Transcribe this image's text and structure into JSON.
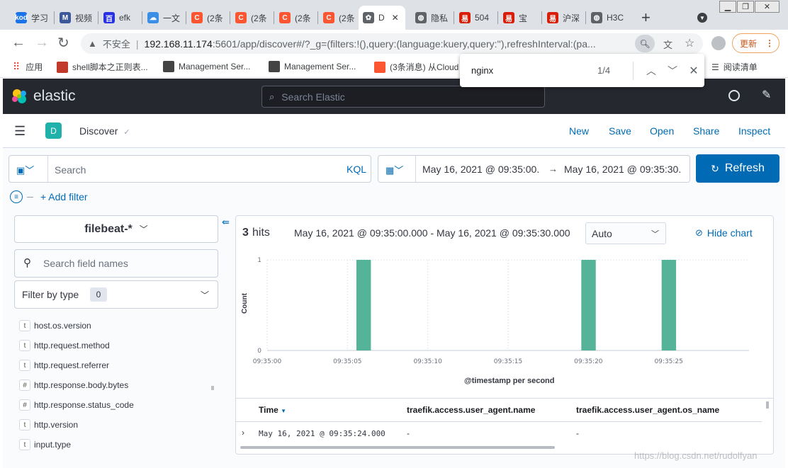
{
  "browser": {
    "tabs": [
      {
        "label": "学习",
        "icon_text": "kod",
        "icon_color": "#1a73e8"
      },
      {
        "label": "视频",
        "icon_text": "M",
        "icon_color": "#3b5998"
      },
      {
        "label": "efk",
        "icon_text": "百",
        "icon_color": "#2932e1"
      },
      {
        "label": "一文",
        "icon_text": "☁",
        "icon_color": "#3a8ee6"
      },
      {
        "label": "(2条",
        "icon_text": "C",
        "icon_color": "#fc5531"
      },
      {
        "label": "(2条",
        "icon_text": "C",
        "icon_color": "#fc5531"
      },
      {
        "label": "(2条",
        "icon_text": "C",
        "icon_color": "#fc5531"
      },
      {
        "label": "(2条",
        "icon_text": "C",
        "icon_color": "#fc5531"
      },
      {
        "label": "D",
        "icon_text": "✿",
        "icon_color": "#5f6368"
      },
      {
        "label": "隐私",
        "icon_text": "◍",
        "icon_color": "#5f6368"
      },
      {
        "label": "504",
        "icon_text": "易",
        "icon_color": "#d81e06"
      },
      {
        "label": "宝",
        "icon_text": "易",
        "icon_color": "#d81e06"
      },
      {
        "label": "沪深",
        "icon_text": "易",
        "icon_color": "#d81e06"
      },
      {
        "label": "H3C",
        "icon_text": "◍",
        "icon_color": "#5f6368"
      }
    ],
    "new_tab": "+",
    "window_controls": [
      "▁",
      "❐",
      "✕"
    ],
    "security_label": "不安全",
    "url_host": "192.168.11.174",
    "url_rest": ":5601/app/discover#/?_g=(filters:!(),query:(language:kuery,query:''),refreshInterval:(pa...",
    "update_label": "更新",
    "bookmarks": [
      {
        "label": "应用",
        "color": "#e8453c"
      },
      {
        "label": "shell脚本之正则表...",
        "color": "#c0392b"
      },
      {
        "label": "Management Ser...",
        "color": "#444"
      },
      {
        "label": "Management Ser...",
        "color": "#444"
      },
      {
        "label": "(3条消息) 从Cloud",
        "color": "#fc5531"
      }
    ],
    "reading_list": "阅读清单",
    "find": {
      "query": "nginx",
      "count": "1/4"
    }
  },
  "kibana": {
    "brand": "elastic",
    "search_placeholder": "Search Elastic",
    "app_badge": "D",
    "breadcrumb": "Discover",
    "nav": [
      "New",
      "Save",
      "Open",
      "Share",
      "Inspect"
    ],
    "query_placeholder": "Search",
    "kql": "KQL",
    "date_start": "May 16, 2021 @ 09:35:00.",
    "date_arrow": "→",
    "date_end": "May 16, 2021 @ 09:35:30.",
    "refresh": "Refresh",
    "add_filter": "+ Add filter",
    "index_pattern": "filebeat-*",
    "field_search_placeholder": "Search field names",
    "filter_by_type": "Filter by type",
    "filter_count": "0",
    "fields": [
      {
        "type": "t",
        "name": "host.os.version"
      },
      {
        "type": "t",
        "name": "http.request.method"
      },
      {
        "type": "t",
        "name": "http.request.referrer"
      },
      {
        "type": "#",
        "name": "http.response.body.bytes"
      },
      {
        "type": "#",
        "name": "http.response.status_code"
      },
      {
        "type": "t",
        "name": "http.version"
      },
      {
        "type": "t",
        "name": "input.type"
      }
    ],
    "hits_count": "3",
    "hits_label": "hits",
    "time_range": "May 16, 2021 @ 09:35:00.000 - May 16, 2021 @ 09:35:30.000",
    "interval": "Auto",
    "hide_chart": "Hide chart",
    "table": {
      "headers": [
        "Time",
        "traefik.access.user_agent.name",
        "traefik.access.user_agent.os_name"
      ],
      "rows": [
        [
          "May 16, 2021 @ 09:35:24.000",
          "-",
          "-"
        ]
      ]
    },
    "watermark": "https://blog.csdn.net/rudolfyan"
  },
  "chart_data": {
    "type": "bar",
    "x": [
      "09:35:06",
      "09:35:20",
      "09:35:25"
    ],
    "values": [
      1,
      1,
      1
    ],
    "xticks": [
      "09:35:00",
      "09:35:05",
      "09:35:10",
      "09:35:15",
      "09:35:20",
      "09:35:25"
    ],
    "yticks": [
      "0",
      "1"
    ],
    "ylabel": "Count",
    "xlabel": "@timestamp per second",
    "ylim": [
      0,
      1
    ],
    "xlim_seconds": [
      0,
      30
    ],
    "bar_color": "#54b399",
    "grid": true
  }
}
